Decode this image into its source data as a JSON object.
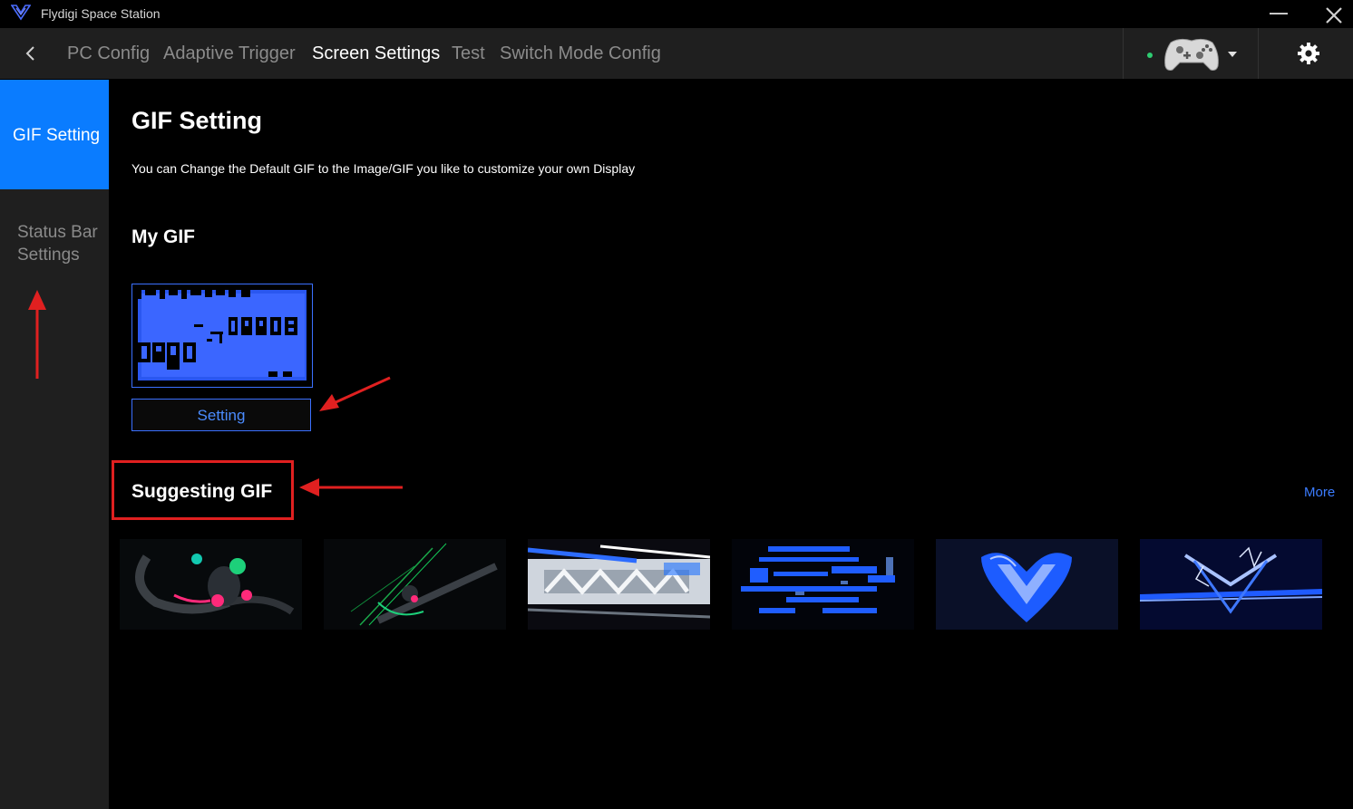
{
  "window": {
    "title": "Flydigi Space Station"
  },
  "nav": {
    "tabs": [
      {
        "label": "PC Config",
        "active": false
      },
      {
        "label": "Adaptive Trigger",
        "active": false
      },
      {
        "label": "Screen Settings",
        "active": true
      },
      {
        "label": "Test",
        "active": false
      },
      {
        "label": "Switch Mode Config",
        "active": false
      }
    ],
    "device_status": "connected"
  },
  "sidebar": {
    "items": [
      {
        "label": "GIF Setting",
        "active": true
      },
      {
        "label": "Status Bar Settings",
        "active": false
      }
    ]
  },
  "main": {
    "title": "GIF Setting",
    "description": "You can Change the Default GIF to the Image/GIF you like to customize your own Display",
    "my_gif": {
      "title": "My GIF",
      "setting_button": "Setting"
    },
    "suggesting": {
      "title": "Suggesting GIF",
      "more_link": "More",
      "thumbnails": [
        "neon-octopus",
        "neon-tentacle",
        "rule-the-glitch",
        "blue-pixel-glitch",
        "blue-fire-logo",
        "blue-lightning-logo"
      ]
    }
  },
  "colors": {
    "accent": "#0a7cff",
    "annotation": "#e02020",
    "status_dot": "#2ecc71"
  }
}
